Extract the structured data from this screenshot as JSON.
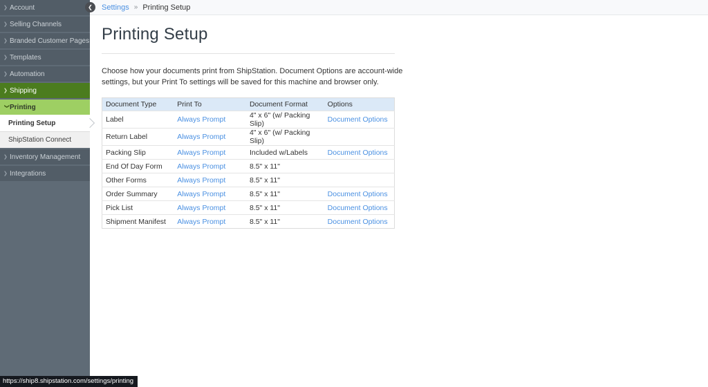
{
  "icons": {
    "chevron_right": "❯",
    "chevron_down": "❯",
    "chevron_left": "❮"
  },
  "sidebar": {
    "items": [
      "Account",
      "Selling Channels",
      "Branded Customer Pages",
      "Templates",
      "Automation",
      "Shipping",
      "Printing",
      "Printing Setup",
      "ShipStation Connect",
      "Inventory Management",
      "Integrations"
    ]
  },
  "breadcrumb": {
    "settings": "Settings",
    "separator": "»",
    "current": "Printing Setup"
  },
  "page": {
    "title": "Printing Setup",
    "description": "Choose how your documents print from ShipStation. Document Options are account-wide settings, but your Print To settings will be saved for this machine and browser only."
  },
  "table": {
    "headers": [
      "Document Type",
      "Print To",
      "Document Format",
      "Options"
    ],
    "rows": [
      {
        "type": "Label",
        "print_to": "Always Prompt",
        "format": "4\" x 6\" (w/ Packing Slip)",
        "options": "Document Options"
      },
      {
        "type": "Return Label",
        "print_to": "Always Prompt",
        "format": "4\" x 6\" (w/ Packing Slip)",
        "options": ""
      },
      {
        "type": "Packing Slip",
        "print_to": "Always Prompt",
        "format": "Included w/Labels",
        "options": "Document Options"
      },
      {
        "type": "End Of Day Form",
        "print_to": "Always Prompt",
        "format": "8.5\" x 11\"",
        "options": ""
      },
      {
        "type": "Other Forms",
        "print_to": "Always Prompt",
        "format": "8.5\" x 11\"",
        "options": ""
      },
      {
        "type": "Order Summary",
        "print_to": "Always Prompt",
        "format": "8.5\" x 11\"",
        "options": "Document Options"
      },
      {
        "type": "Pick List",
        "print_to": "Always Prompt",
        "format": "8.5\" x 11\"",
        "options": "Document Options"
      },
      {
        "type": "Shipment Manifest",
        "print_to": "Always Prompt",
        "format": "8.5\" x 11\"",
        "options": "Document Options"
      }
    ]
  },
  "status_bar": {
    "url": "https://ship8.shipstation.com/settings/printing"
  },
  "colors": {
    "sidebar_base": "#5f6b76",
    "sidebar_item": "#525d67",
    "shipping_active_green": "#4b7c1e",
    "printing_expanded_green": "#9ecf63",
    "link_blue": "#4a90e2",
    "table_header_blue": "#dbe9f7",
    "breadcrumb_bar_bg": "#f8f9fb",
    "status_bar_bg": "#16191f"
  }
}
